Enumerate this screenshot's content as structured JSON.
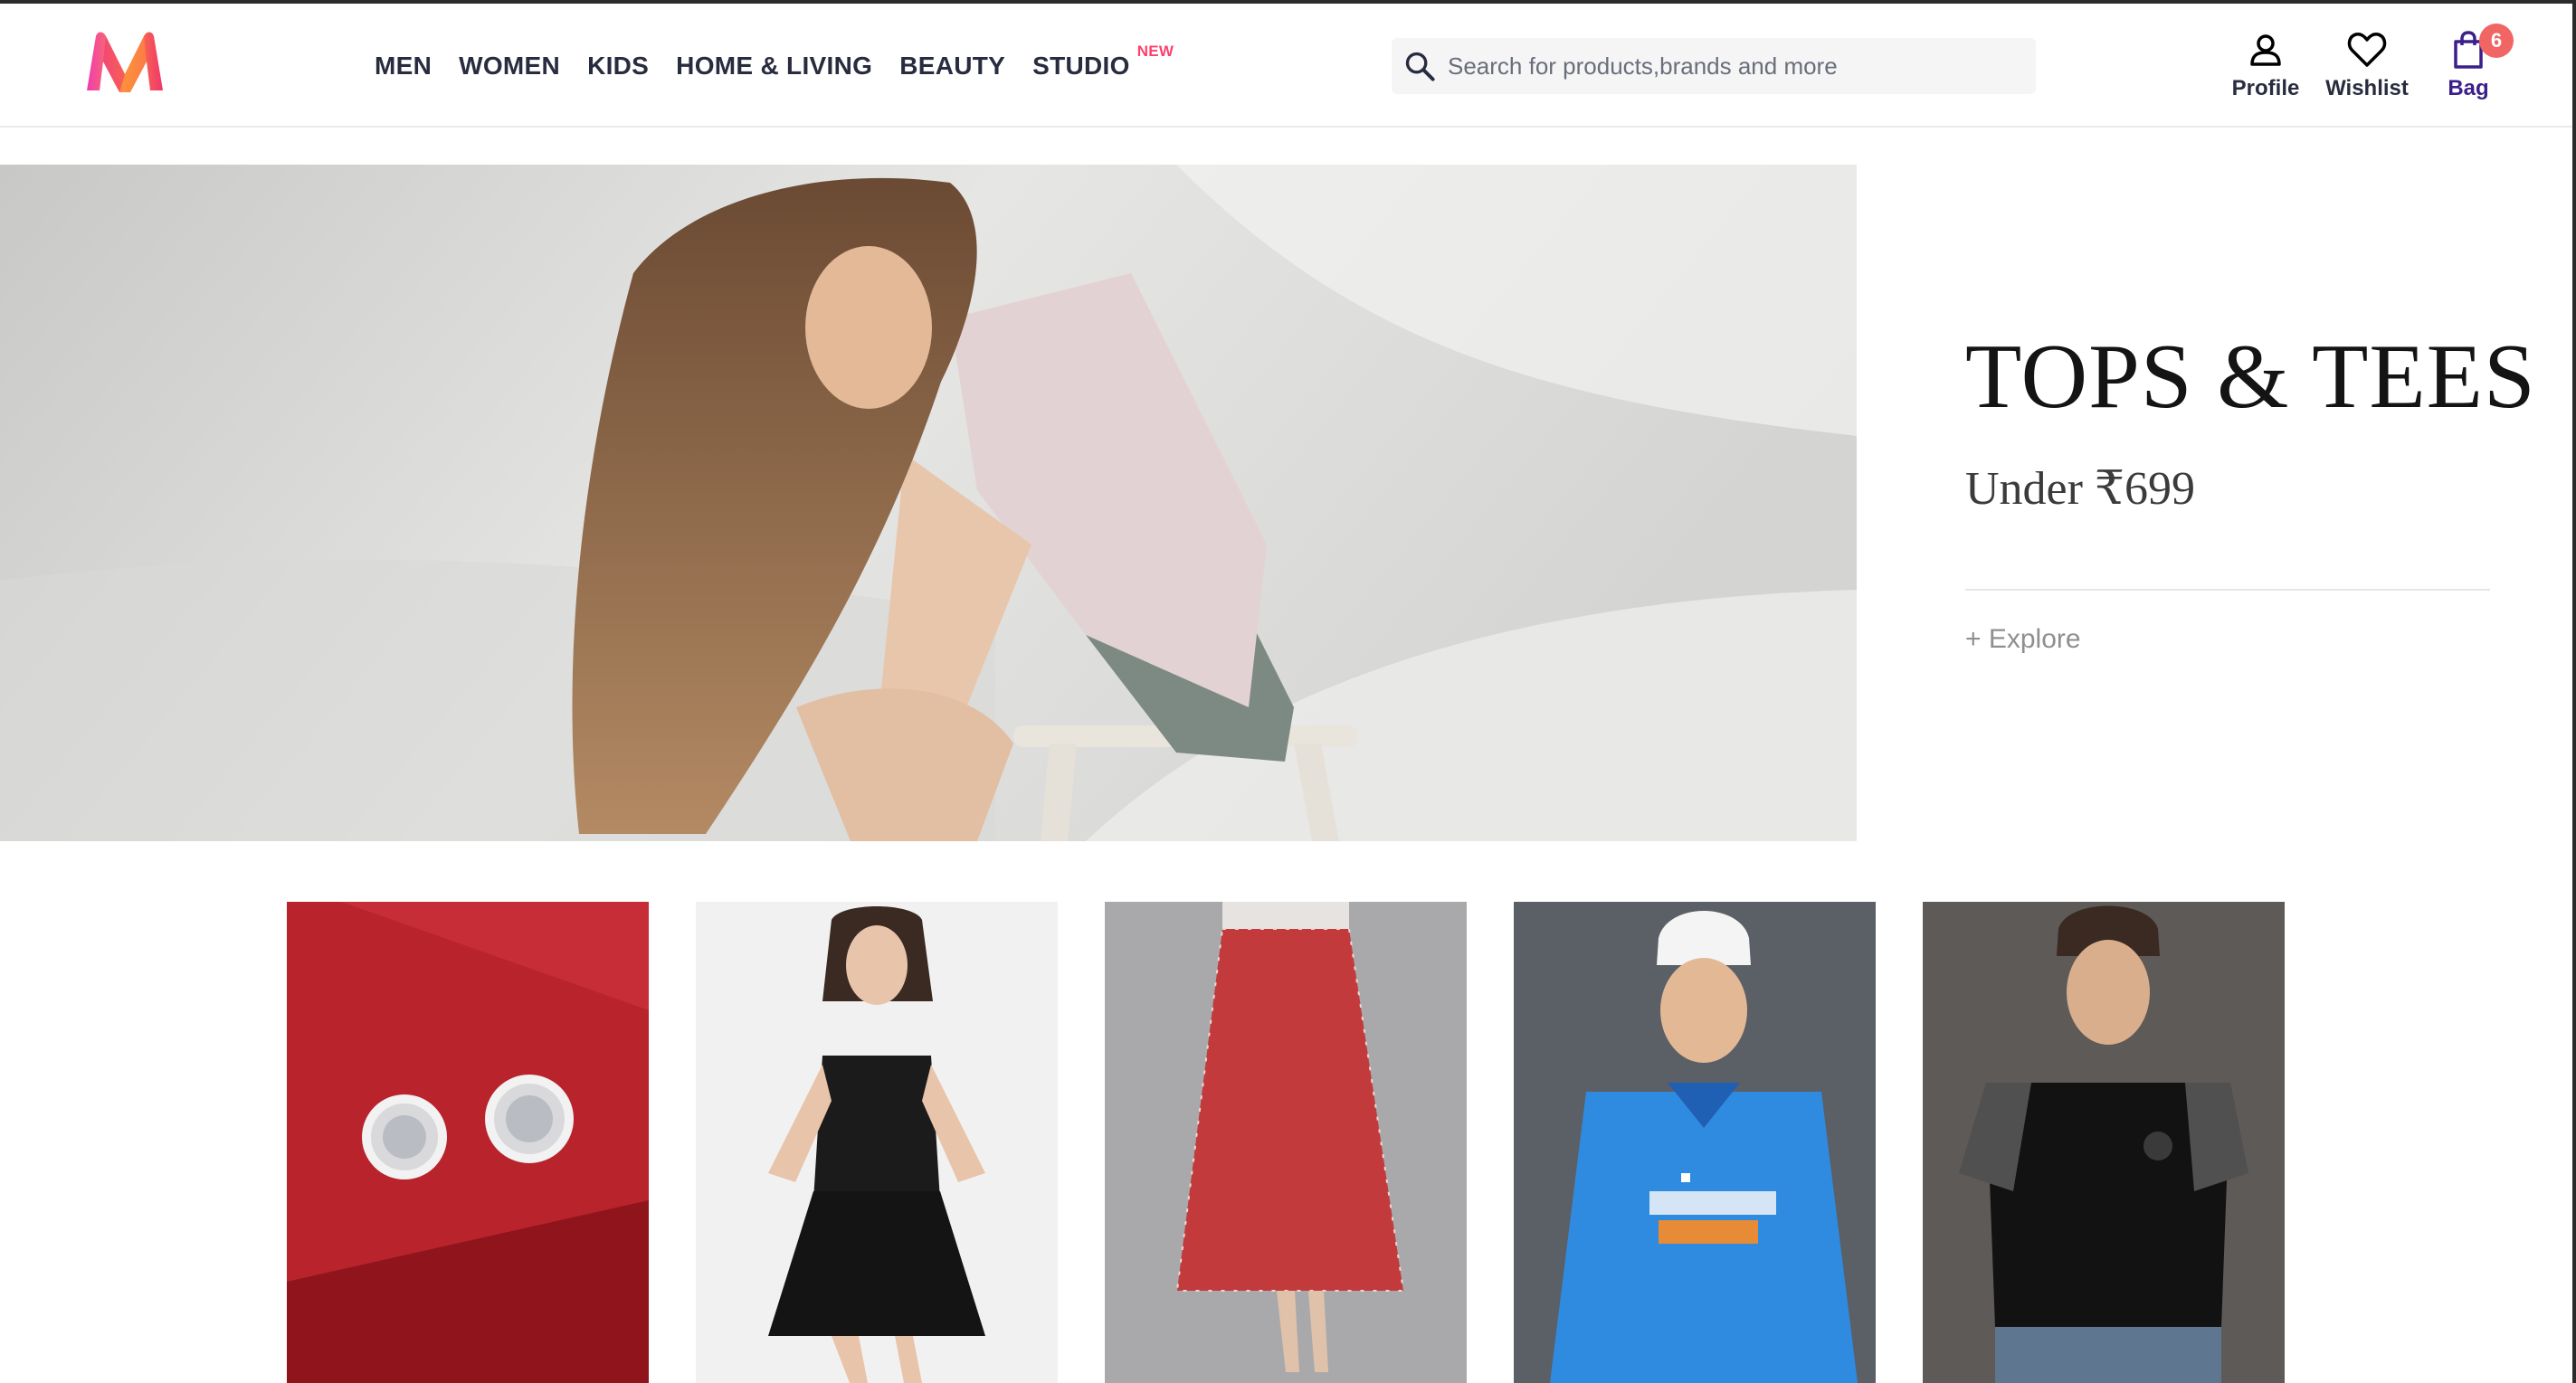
{
  "header": {
    "logo_icon": "myntra-logo-icon",
    "nav": [
      {
        "label": "MEN"
      },
      {
        "label": "WOMEN"
      },
      {
        "label": "KIDS"
      },
      {
        "label": "HOME & LIVING"
      },
      {
        "label": "BEAUTY"
      },
      {
        "label": "STUDIO",
        "tag": "NEW"
      }
    ],
    "search": {
      "placeholder": "Search for products,brands and more",
      "icon": "search-icon"
    },
    "actions": {
      "profile": {
        "label": "Profile",
        "icon": "person-icon"
      },
      "wishlist": {
        "label": "Wishlist",
        "icon": "heart-icon"
      },
      "bag": {
        "label": "Bag",
        "icon": "bag-icon",
        "count": "6"
      }
    }
  },
  "hero": {
    "title": "TOPS & TEES",
    "subtitle": "Under ₹699",
    "cta": "+ Explore"
  },
  "tiles": [
    {
      "icon": "earrings-product-image"
    },
    {
      "icon": "black-dress-product-image"
    },
    {
      "icon": "floral-skirt-product-image"
    },
    {
      "icon": "india-jersey-product-image"
    },
    {
      "icon": "black-polo-product-image"
    }
  ],
  "colors": {
    "accent": "#ff3f6c",
    "text": "#282c3f",
    "bag_label": "#3b1f8b",
    "badge": "#f16565"
  }
}
